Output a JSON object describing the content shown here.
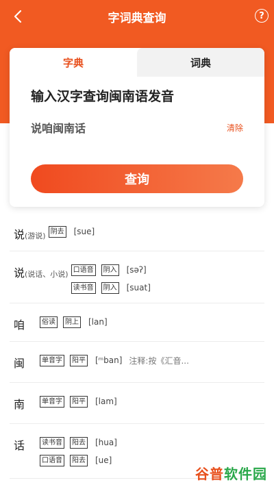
{
  "topbar": {
    "title": "字词典查询",
    "help": "?"
  },
  "tabs": [
    {
      "label": "字典"
    },
    {
      "label": "词典"
    }
  ],
  "search": {
    "prompt": "输入汉字查询闽南语发音",
    "value": "说咱闽南话",
    "clear_label": "清除",
    "button_label": "查询"
  },
  "results": [
    {
      "char": "说",
      "note": "(游说)",
      "readings": [
        {
          "tags": [
            "阴去"
          ],
          "pron": "[sue]"
        }
      ]
    },
    {
      "char": "说",
      "note": "(说话、小说)",
      "readings": [
        {
          "tags": [
            "口语音",
            "阴入"
          ],
          "pron": "[səʔ]"
        },
        {
          "tags": [
            "读书音",
            "阴入"
          ],
          "pron": "[suat]"
        }
      ]
    },
    {
      "char": "咱",
      "note": "",
      "readings": [
        {
          "tags": [
            "俗读",
            "阴上"
          ],
          "pron": "[lan]"
        }
      ]
    },
    {
      "char": "闽",
      "note": "",
      "readings": [
        {
          "tags": [
            "单音字",
            "阳平"
          ],
          "pron": "[ᵐban]",
          "extra": "注释:按《汇音..."
        }
      ]
    },
    {
      "char": "南",
      "note": "",
      "readings": [
        {
          "tags": [
            "单音字",
            "阳平"
          ],
          "pron": "[lam]"
        }
      ]
    },
    {
      "char": "话",
      "note": "",
      "readings": [
        {
          "tags": [
            "读书音",
            "阳去"
          ],
          "pron": "[hua]"
        },
        {
          "tags": [
            "口语音",
            "阳去"
          ],
          "pron": "[ue]"
        }
      ]
    }
  ],
  "watermark": {
    "part1": "谷普",
    "part2": "软件园"
  },
  "colors": {
    "accent": "#f15a22",
    "watermark": "#2aa84a"
  }
}
